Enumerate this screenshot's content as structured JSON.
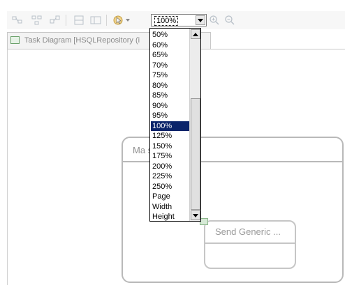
{
  "toolbar": {
    "zoom_value": "100%",
    "icons": [
      "layout-icon",
      "align-icon",
      "arrange-icon",
      "page-icon",
      "view-icon",
      "select-icon",
      "dropdown-arrow-icon",
      "zoom-in-icon",
      "zoom-out-icon"
    ]
  },
  "tab": {
    "title": "Task Diagram [HSQLRepository (i"
  },
  "zoom_options": {
    "selected": "100%",
    "items": [
      "50%",
      "60%",
      "65%",
      "70%",
      "75%",
      "80%",
      "85%",
      "90%",
      "95%",
      "100%",
      "125%",
      "150%",
      "175%",
      "200%",
      "225%",
      "250%",
      "Page",
      "Width",
      "Height"
    ]
  },
  "diagram": {
    "outer_title": "Ma                  s",
    "inner_title": "Send Generic ..."
  },
  "colors": {
    "selection": "#0a246a",
    "shape_border": "#b9b9b9"
  }
}
